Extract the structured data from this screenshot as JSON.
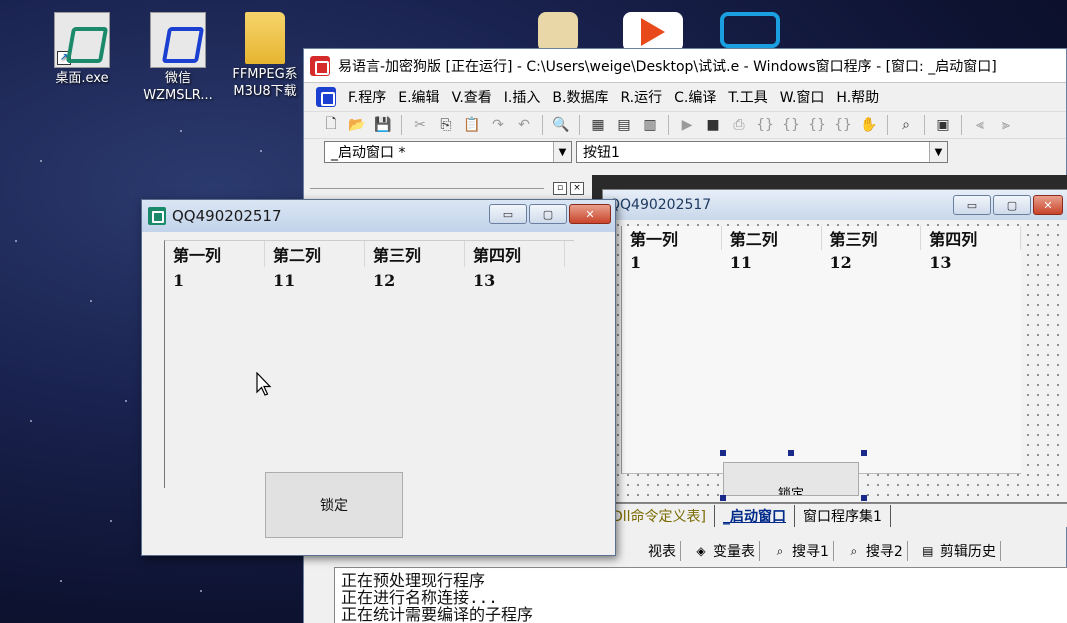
{
  "desktop": {
    "icons": [
      {
        "label": "桌面.exe",
        "icon": "easy-language-icon"
      },
      {
        "label": "微信\nWZMSLR...",
        "icon": "easy-language-icon"
      },
      {
        "label": "FFMPEG系\nM3U8下载",
        "icon": "folder-icon"
      }
    ]
  },
  "ide": {
    "title": "易语言-加密狗版 [正在运行] - C:\\Users\\weige\\Desktop\\试试.e - Windows窗口程序 - [窗口: _启动窗口]",
    "menu": [
      "F.程序",
      "E.编辑",
      "V.查看",
      "I.插入",
      "B.数据库",
      "R.运行",
      "C.编译",
      "T.工具",
      "W.窗口",
      "H.帮助"
    ],
    "combo_window": "_启动窗口 *",
    "combo_control": "按钮1",
    "design_form_title": "QQ490202517",
    "design_columns": [
      "第一列",
      "第二列",
      "第三列",
      "第四列"
    ],
    "design_row": [
      "1",
      "11",
      "12",
      "13"
    ],
    "design_button_label": "锁定",
    "tabs": [
      "Dll命令定义表]",
      "_启动窗口",
      "窗口程序集1"
    ],
    "bottom_tabs": [
      "视表",
      "变量表",
      "搜寻1",
      "搜寻2",
      "剪辑历史"
    ],
    "output_lines": [
      "正在预处理现行程序",
      "正在进行名称连接...",
      "正在统计需要编译的子程序"
    ]
  },
  "running_window": {
    "title": "QQ490202517",
    "columns": [
      "第一列",
      "第二列",
      "第三列",
      "第四列"
    ],
    "rows": [
      [
        "1",
        "11",
        "12",
        "13"
      ]
    ],
    "button_label": "锁定"
  }
}
